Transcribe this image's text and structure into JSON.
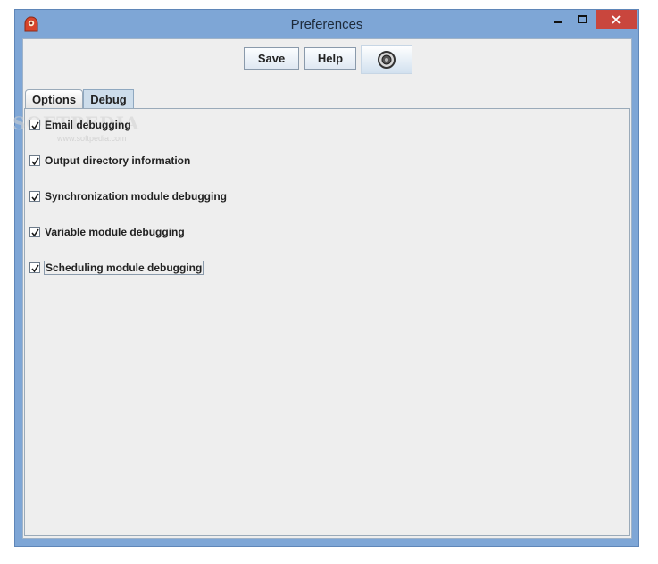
{
  "window": {
    "title": "Preferences",
    "controls": {
      "minimize": "minimize",
      "maximize": "maximize",
      "close": "close"
    },
    "close_color": "#c9463d"
  },
  "toolbar": {
    "save_label": "Save",
    "help_label": "Help",
    "dial_icon": "target-dial-icon"
  },
  "tabs": [
    {
      "label": "Options",
      "selected": false
    },
    {
      "label": "Debug",
      "selected": true
    }
  ],
  "debug_options": [
    {
      "label": "Email debugging",
      "checked": true
    },
    {
      "label": "Output directory information",
      "checked": true
    },
    {
      "label": "Synchronization module debugging",
      "checked": true
    },
    {
      "label": "Variable module debugging",
      "checked": true
    },
    {
      "label": "Scheduling module debugging",
      "checked": true
    }
  ],
  "watermark": {
    "main": "SOFTPEDIA",
    "sub": "www.softpedia.com"
  }
}
